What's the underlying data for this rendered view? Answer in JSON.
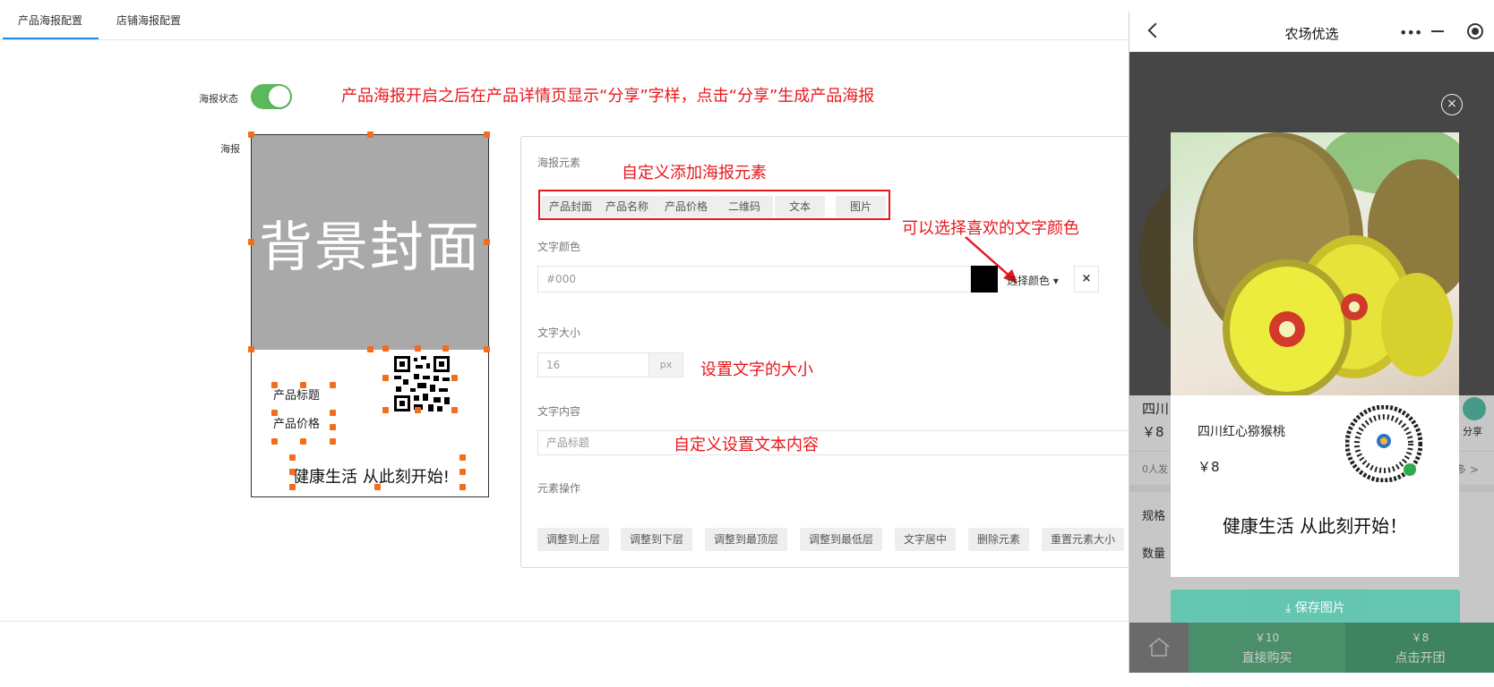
{
  "tabs": [
    {
      "label": "产品海报配置"
    },
    {
      "label": "店铺海报配置"
    }
  ],
  "toggle": {
    "label": "海报状态",
    "on": true
  },
  "annotations": {
    "status_note": "产品海报开启之后在产品详情页显示“分享”字样，点击“分享”生成产品海报",
    "elements_note": "自定义添加海报元素",
    "color_note": "可以选择喜欢的文字颜色",
    "size_note": "设置文字的大小",
    "content_note": "自定义设置文本内容"
  },
  "poster": {
    "label": "海报",
    "background_text": "背景封面",
    "title_text": "产品标题",
    "price_text": "产品价格",
    "slogan": "健康生活 从此刻开始!"
  },
  "config": {
    "elements_label": "海报元素",
    "elements": [
      "产品封面",
      "产品名称",
      "产品价格",
      "二维码",
      "文本",
      "图片"
    ],
    "color_label": "文字颜色",
    "color_value": "#000",
    "color_swatch": "#000000",
    "pick_color": "选择颜色",
    "clear_symbol": "×",
    "size_label": "文字大小",
    "size_value": "16",
    "size_unit": "px",
    "content_label": "文字内容",
    "content_value": "产品标题",
    "ops_label": "元素操作",
    "ops": [
      "调整到上层",
      "调整到下层",
      "调整到最顶层",
      "调整到最低层",
      "文字居中",
      "删除元素",
      "重置元素大小"
    ]
  },
  "phone": {
    "title": "农场优选",
    "close_symbol": "×",
    "bg_rows": {
      "product_partial": "四川",
      "price_partial": "￥8",
      "share_label": "分享",
      "sold_partial": "0人发",
      "more_partial": "更多 >",
      "spec_label": "规格",
      "qty_label": "数量"
    },
    "card": {
      "title": "四川红心猕猴桃",
      "price": "￥8",
      "slogan": "健康生活 从此刻开始！"
    },
    "save_button": "保存图片",
    "buy_price": "￥10",
    "buy_label": "直接购买",
    "group_price": "￥8",
    "group_label": "点击开团"
  },
  "colors": {
    "accent": "#1e88e5",
    "toggle_on": "#5cb85c",
    "annotation_red": "#e8171c",
    "handle": "#f26d1d",
    "save_button": "#5cc6b0"
  }
}
